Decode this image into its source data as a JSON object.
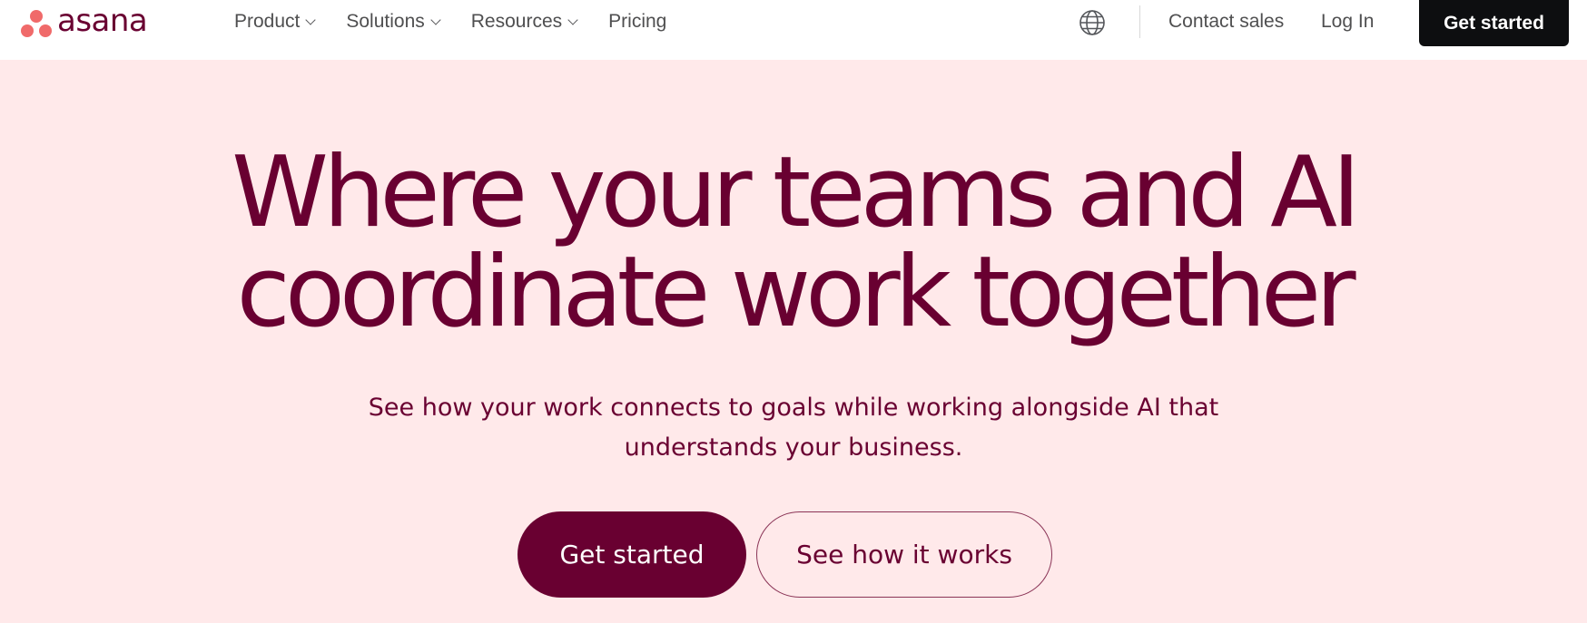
{
  "brand": {
    "logo_text": "asana",
    "logo_color": "#f06a6a",
    "primary_color": "#690031"
  },
  "nav": {
    "items": [
      {
        "label": "Product",
        "dropdown": true
      },
      {
        "label": "Solutions",
        "dropdown": true
      },
      {
        "label": "Resources",
        "dropdown": true
      },
      {
        "label": "Pricing",
        "dropdown": false
      }
    ],
    "language_icon": "globe-icon",
    "contact_label": "Contact sales",
    "login_label": "Log In",
    "cta_label": "Get started"
  },
  "hero": {
    "headline_line1": "Where your teams and AI",
    "headline_line2": "coordinate work together",
    "subtitle_line1": "See how your work connects to goals while working alongside AI that",
    "subtitle_line2": "understands your business.",
    "primary_cta": "Get started",
    "secondary_cta": "See how it works"
  },
  "colors": {
    "hero_bg": "#ffe9ea",
    "header_bg": "#ffffff",
    "dark_button": "#0d0e10",
    "text": "#690031"
  }
}
